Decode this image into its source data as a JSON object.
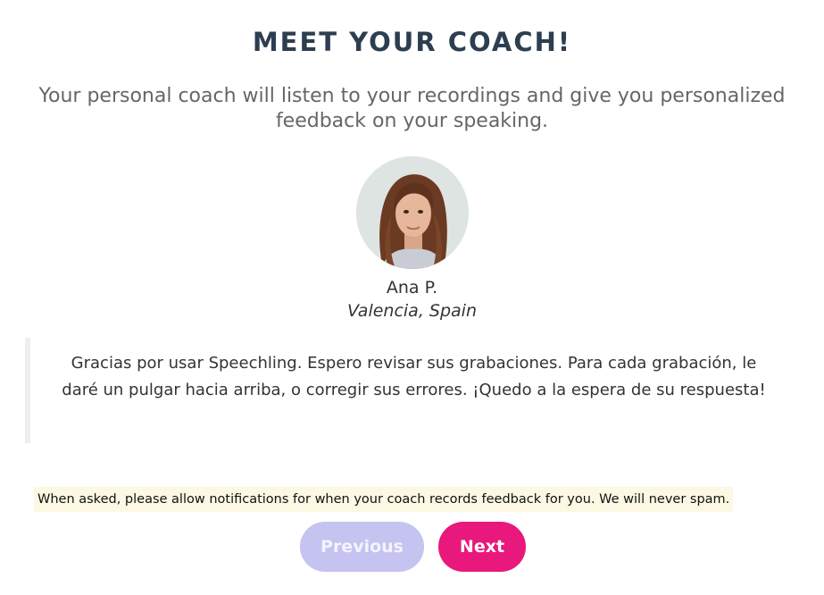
{
  "header": {
    "title": "MEET YOUR COACH!",
    "subtitle": "Your personal coach will listen to your recordings and give you personalized feedback on your speaking."
  },
  "coach": {
    "name": "Ana P.",
    "location": "Valencia, Spain",
    "message": "Gracias por usar Speechling. Espero revisar sus grabaciones. Para cada grabación, le daré un pulgar hacia arriba, o corregir sus errores. ¡Quedo a la espera de su respuesta!"
  },
  "notice": {
    "text": "When asked, please allow notifications for when your coach records feedback for you. We will never spam."
  },
  "buttons": {
    "previous_label": "Previous",
    "next_label": "Next"
  },
  "colors": {
    "title": "#2d3e50",
    "next_button": "#e8187c",
    "previous_button_disabled": "#c5c3f0",
    "notice_background": "#fcf8e3"
  }
}
